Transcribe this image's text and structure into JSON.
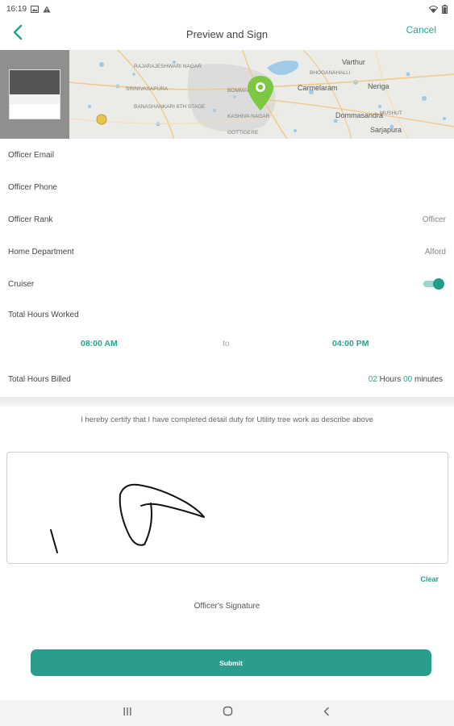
{
  "status_bar": {
    "time": "16:19"
  },
  "header": {
    "title": "Preview and Sign",
    "cancel_label": "Cancel",
    "back_icon": "chevron-left-icon"
  },
  "map": {
    "labels": [
      "RAJARAJESHWARI NAGAR",
      "SRINIVASAPURA",
      "BANASHANKARI 6TH STAGE",
      "BOMMANAHALLI",
      "KASHIVA NAGAR",
      "GOTTIGERE",
      "Varthur",
      "BHOGANAHALLI",
      "Carmelaram",
      "Neriga",
      "Dommasandra",
      "Sarjapura",
      "MUSHUT"
    ],
    "pin_color": "#7cc840"
  },
  "fields": [
    {
      "label": "Officer Email",
      "value": ""
    },
    {
      "label": "Officer Phone",
      "value": ""
    },
    {
      "label": "Officer Rank",
      "value": "Officer"
    },
    {
      "label": "Home Department",
      "value": "Alford"
    }
  ],
  "cruiser": {
    "label": "Cruiser",
    "on": true
  },
  "hours": {
    "label": "Total Hours Worked",
    "start": "08:00 AM",
    "to": "to",
    "end": "04:00 PM"
  },
  "billed": {
    "label": "Total Hours Billed",
    "hours": "02",
    "hours_unit": "Hours",
    "minutes": "00",
    "minutes_unit": "minutes"
  },
  "certify_text": "I hereby certify that I have completed detail duty for Utility tree work as describe above",
  "signature": {
    "clear_label": "Clear",
    "caption": "Officer's Signature"
  },
  "submit_label": "Submit",
  "colors": {
    "accent": "#2aa391",
    "submit": "#2a9d8c"
  }
}
